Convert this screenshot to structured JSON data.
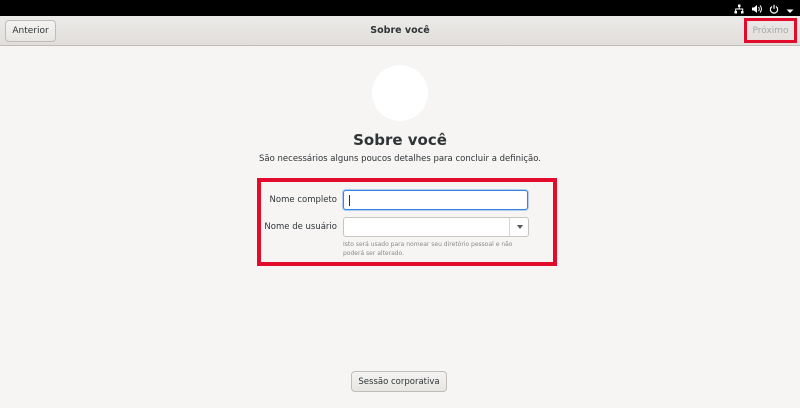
{
  "tray": {
    "icons": [
      "network-icon",
      "volume-icon",
      "power-icon",
      "menu-arrow-icon"
    ]
  },
  "header": {
    "title": "Sobre você",
    "prev_label": "Anterior",
    "next_label": "Próximo"
  },
  "main": {
    "title": "Sobre você",
    "subtitle": "São necessários alguns poucos detalhes para concluir a definição."
  },
  "form": {
    "full_name_label": "Nome completo",
    "full_name_value": "",
    "username_label": "Nome de usuário",
    "username_value": "",
    "username_hint": "Isto será usado para nomear seu diretório pessoal e não poderá ser alterado."
  },
  "footer": {
    "enterprise_label": "Sessão corporativa"
  },
  "colors": {
    "highlight": "#e30b2c",
    "focus": "#3584e4",
    "background": "#f6f5f4"
  }
}
